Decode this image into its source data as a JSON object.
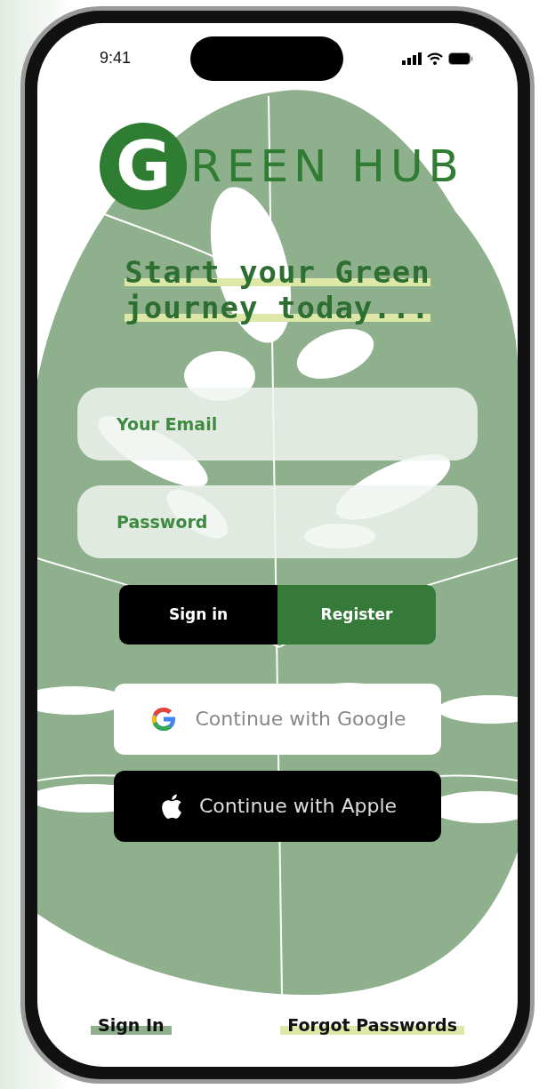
{
  "status_bar": {
    "time": "9:41"
  },
  "logo": {
    "initial": "G",
    "rest": "REEN HUB"
  },
  "headline": [
    "Start your Green",
    "journey today..."
  ],
  "fields": [
    {
      "placeholder": "Your Email"
    },
    {
      "placeholder": "Password"
    }
  ],
  "segments": [
    {
      "label": "Sign in",
      "selected": true
    },
    {
      "label": "Register",
      "selected": false
    }
  ],
  "social_buttons": [
    {
      "kind": "google",
      "label": "Continue with Google"
    },
    {
      "kind": "apple",
      "label": "Continue with Apple"
    }
  ],
  "footer_links": [
    {
      "label": "Sign In",
      "color": "#8fb08d"
    },
    {
      "label": "Forgot Passwords",
      "color": "#dde8a8"
    }
  ]
}
